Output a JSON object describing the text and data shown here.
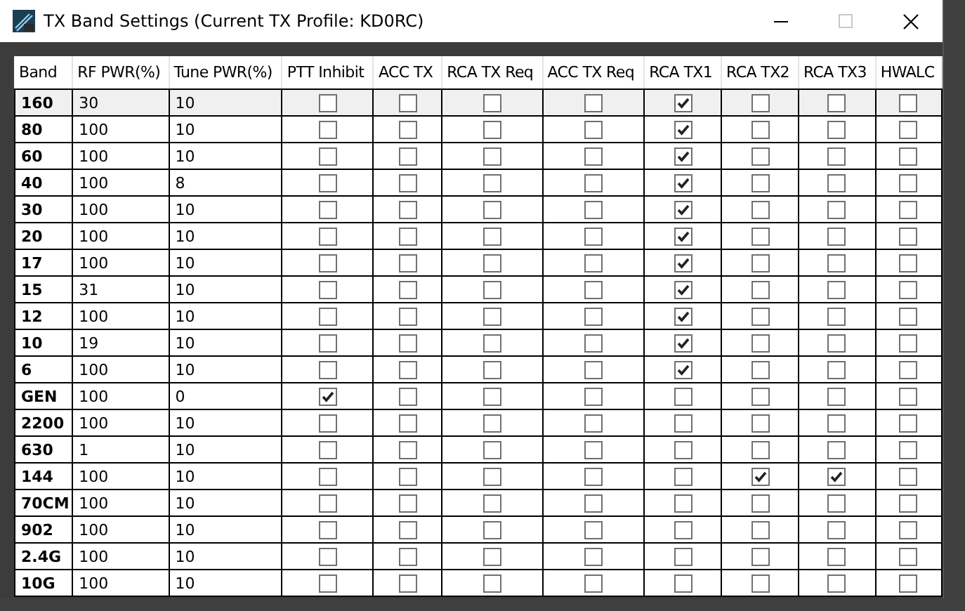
{
  "window": {
    "title": "TX Band Settings (Current TX Profile: KD0RC)"
  },
  "table": {
    "columns": [
      "Band",
      "RF PWR(%)",
      "Tune PWR(%)",
      "PTT Inhibit",
      "ACC TX",
      "RCA TX Req",
      "ACC TX Req",
      "RCA TX1",
      "RCA TX2",
      "RCA TX3",
      "HWALC"
    ],
    "rows": [
      {
        "band": "160",
        "rf_pwr": "30",
        "tune_pwr": "10",
        "selected": true,
        "checks": [
          false,
          false,
          false,
          false,
          true,
          false,
          false,
          false
        ]
      },
      {
        "band": "80",
        "rf_pwr": "100",
        "tune_pwr": "10",
        "selected": false,
        "checks": [
          false,
          false,
          false,
          false,
          true,
          false,
          false,
          false
        ]
      },
      {
        "band": "60",
        "rf_pwr": "100",
        "tune_pwr": "10",
        "selected": false,
        "checks": [
          false,
          false,
          false,
          false,
          true,
          false,
          false,
          false
        ]
      },
      {
        "band": "40",
        "rf_pwr": "100",
        "tune_pwr": "8",
        "selected": false,
        "checks": [
          false,
          false,
          false,
          false,
          true,
          false,
          false,
          false
        ]
      },
      {
        "band": "30",
        "rf_pwr": "100",
        "tune_pwr": "10",
        "selected": false,
        "checks": [
          false,
          false,
          false,
          false,
          true,
          false,
          false,
          false
        ]
      },
      {
        "band": "20",
        "rf_pwr": "100",
        "tune_pwr": "10",
        "selected": false,
        "checks": [
          false,
          false,
          false,
          false,
          true,
          false,
          false,
          false
        ]
      },
      {
        "band": "17",
        "rf_pwr": "100",
        "tune_pwr": "10",
        "selected": false,
        "checks": [
          false,
          false,
          false,
          false,
          true,
          false,
          false,
          false
        ]
      },
      {
        "band": "15",
        "rf_pwr": "31",
        "tune_pwr": "10",
        "selected": false,
        "checks": [
          false,
          false,
          false,
          false,
          true,
          false,
          false,
          false
        ]
      },
      {
        "band": "12",
        "rf_pwr": "100",
        "tune_pwr": "10",
        "selected": false,
        "checks": [
          false,
          false,
          false,
          false,
          true,
          false,
          false,
          false
        ]
      },
      {
        "band": "10",
        "rf_pwr": "19",
        "tune_pwr": "10",
        "selected": false,
        "checks": [
          false,
          false,
          false,
          false,
          true,
          false,
          false,
          false
        ]
      },
      {
        "band": "6",
        "rf_pwr": "100",
        "tune_pwr": "10",
        "selected": false,
        "checks": [
          false,
          false,
          false,
          false,
          true,
          false,
          false,
          false
        ]
      },
      {
        "band": "GEN",
        "rf_pwr": "100",
        "tune_pwr": "0",
        "selected": false,
        "checks": [
          true,
          false,
          false,
          false,
          false,
          false,
          false,
          false
        ]
      },
      {
        "band": "2200",
        "rf_pwr": "100",
        "tune_pwr": "10",
        "selected": false,
        "checks": [
          false,
          false,
          false,
          false,
          false,
          false,
          false,
          false
        ]
      },
      {
        "band": "630",
        "rf_pwr": "1",
        "tune_pwr": "10",
        "selected": false,
        "checks": [
          false,
          false,
          false,
          false,
          false,
          false,
          false,
          false
        ]
      },
      {
        "band": "144",
        "rf_pwr": "100",
        "tune_pwr": "10",
        "selected": false,
        "checks": [
          false,
          false,
          false,
          false,
          false,
          true,
          true,
          false
        ]
      },
      {
        "band": "70CM",
        "rf_pwr": "100",
        "tune_pwr": "10",
        "selected": false,
        "checks": [
          false,
          false,
          false,
          false,
          false,
          false,
          false,
          false
        ]
      },
      {
        "band": "902",
        "rf_pwr": "100",
        "tune_pwr": "10",
        "selected": false,
        "checks": [
          false,
          false,
          false,
          false,
          false,
          false,
          false,
          false
        ]
      },
      {
        "band": "2.4G",
        "rf_pwr": "100",
        "tune_pwr": "10",
        "selected": false,
        "checks": [
          false,
          false,
          false,
          false,
          false,
          false,
          false,
          false
        ]
      },
      {
        "band": "10G",
        "rf_pwr": "100",
        "tune_pwr": "10",
        "selected": false,
        "checks": [
          false,
          false,
          false,
          false,
          false,
          false,
          false,
          false
        ]
      }
    ]
  }
}
